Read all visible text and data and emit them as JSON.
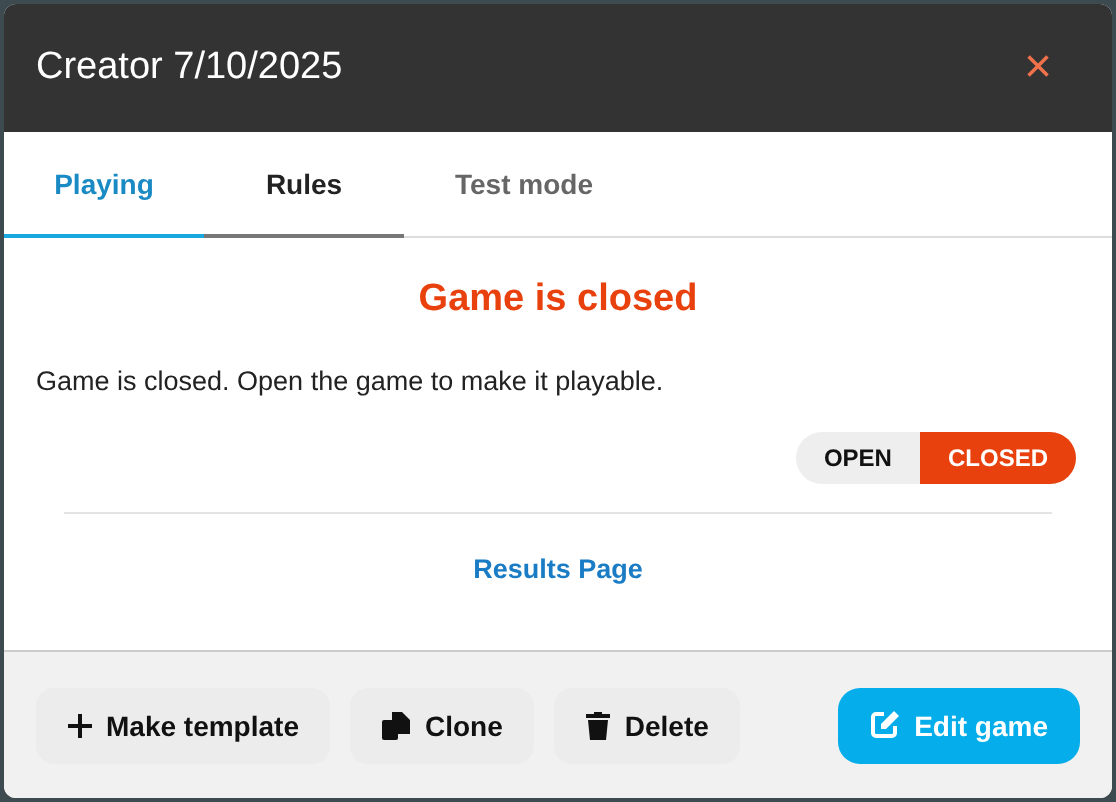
{
  "window": {
    "title": "Creator 7/10/2025",
    "close": "×"
  },
  "tabs": [
    {
      "label": "Playing",
      "selected": true,
      "disabled": false
    },
    {
      "label": "Rules",
      "selected": false,
      "disabled": false
    },
    {
      "label": "Test mode",
      "selected": false,
      "disabled": true
    }
  ],
  "status": {
    "heading": "Game is closed",
    "message": "Game is closed. Open the game to make it playable."
  },
  "toggle": [
    {
      "label": "OPEN",
      "selected": false
    },
    {
      "label": "CLOSED",
      "selected": true
    }
  ],
  "link": "Results Page",
  "buttons": [
    {
      "kind": "plus",
      "label": "Make template",
      "primary": false
    },
    {
      "kind": "copy",
      "label": "Clone",
      "primary": false
    },
    {
      "kind": "trash",
      "label": "Delete",
      "primary": false
    },
    {
      "kind": "edit",
      "label": "Edit game",
      "primary": true
    }
  ]
}
